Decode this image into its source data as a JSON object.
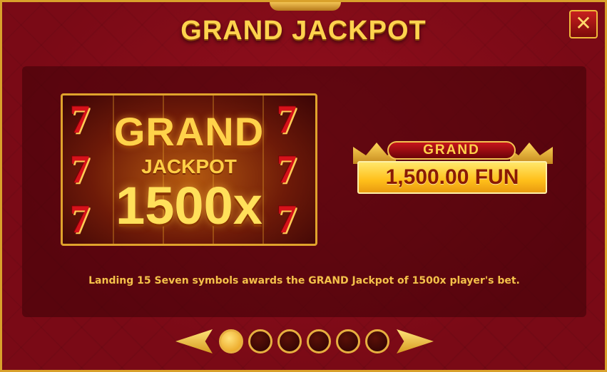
{
  "title": "GRAND JACKPOT",
  "close_button": "✕",
  "illustration": {
    "grand": "GRAND",
    "jackpot": "JACKPOT",
    "multiplier": "1500x",
    "symbol": "7"
  },
  "badge": {
    "label": "GRAND",
    "value": "1,500.00 FUN"
  },
  "description": "Landing 15 Seven symbols awards the GRAND Jackpot of 1500x player's bet.",
  "pager": {
    "pages": 6,
    "active_page": 1
  },
  "colors": {
    "background": "#7a0a16",
    "gold": "#ffd34e",
    "frame": "#d9a12b"
  }
}
